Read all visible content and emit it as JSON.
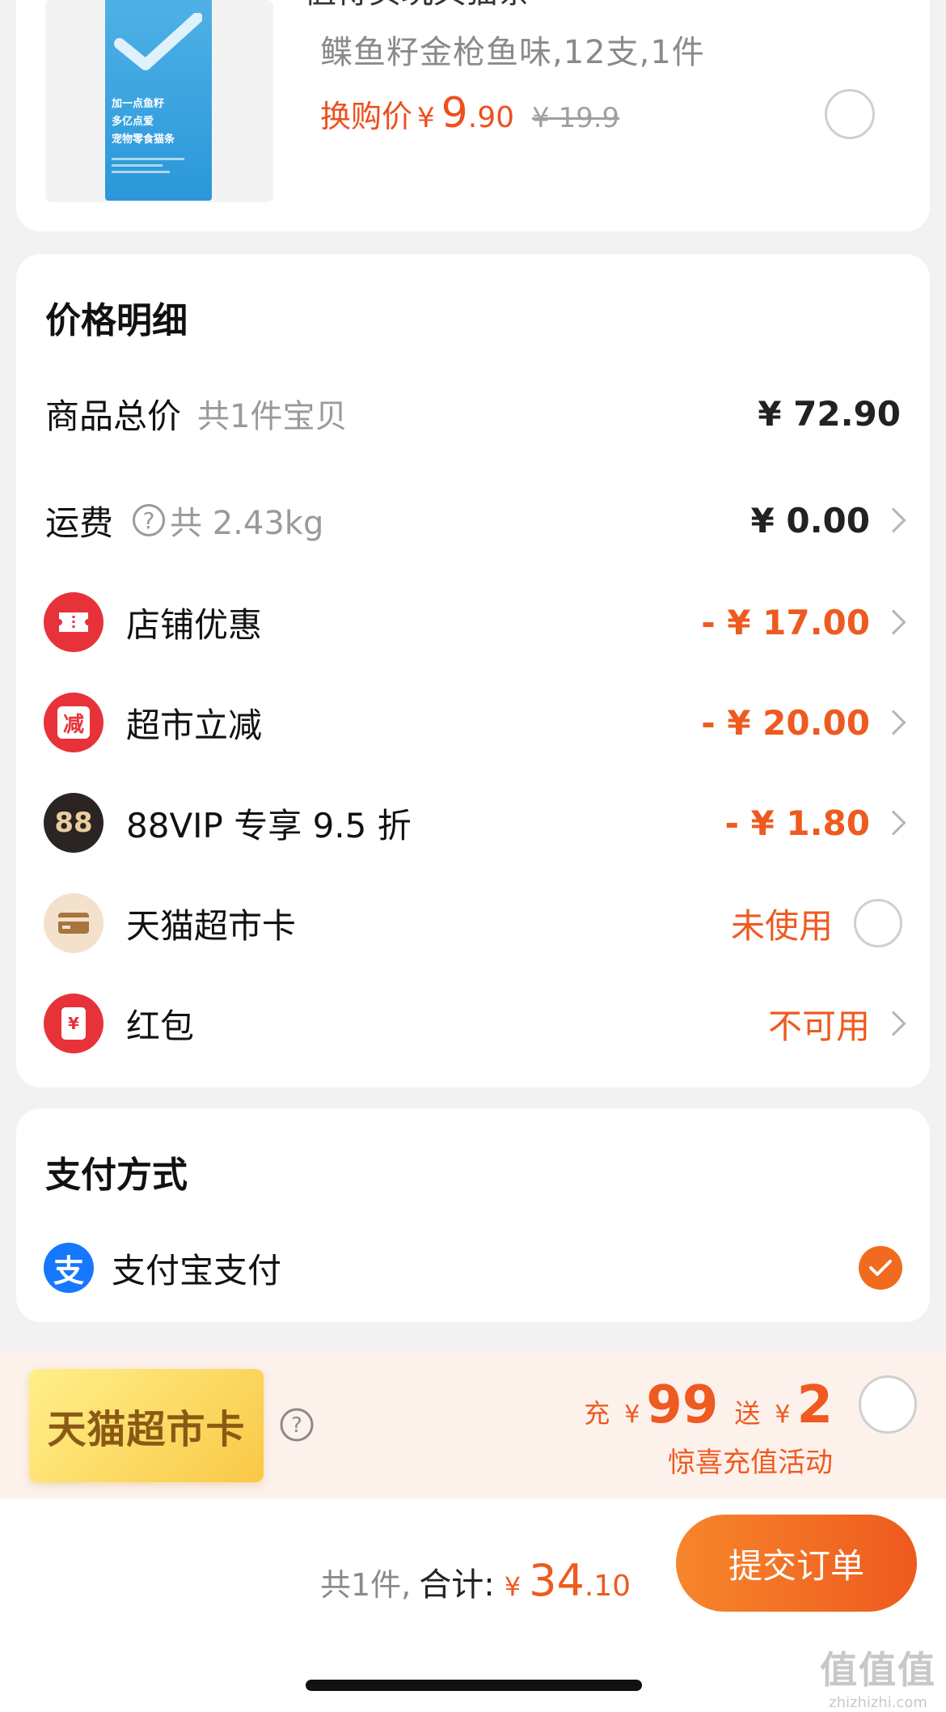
{
  "product": {
    "cut_title": "值得买玩具猫条",
    "spec": "鲽鱼籽金枪鱼味,12支,1件",
    "price_label": "换购价",
    "currency": "¥",
    "price_int": "9",
    "price_dec": ".90",
    "original_price": "¥ 19.9",
    "package_text_1": "加一点鱼籽",
    "package_text_2": "多亿点爱",
    "package_text_3": "宠物零食猫条",
    "selected": false
  },
  "price_detail": {
    "title": "价格明细",
    "rows": [
      {
        "label": "商品总价",
        "sub": "共1件宝贝",
        "value": "¥ 72.90"
      },
      {
        "label": "运费",
        "sub": "共 2.43kg",
        "value": "¥ 0.00",
        "icon": "question-icon"
      },
      {
        "label": "店铺优惠",
        "value": "- ¥ 17.00",
        "icon": "coupon-icon",
        "color": "#ee5a1f"
      },
      {
        "label": "超市立减",
        "value": "- ¥ 20.00",
        "icon": "reduce-icon",
        "icon_text": "减",
        "color": "#ee5a1f"
      },
      {
        "label": "88VIP 专享 9.5 折",
        "value": "- ¥ 1.80",
        "icon": "vip88-icon",
        "icon_text": "88",
        "color": "#ee5a1f"
      },
      {
        "label": "天猫超市卡",
        "value": "未使用",
        "icon": "card-icon",
        "selected": false
      },
      {
        "label": "红包",
        "value": "不可用",
        "icon": "red-packet-icon",
        "icon_text": "¥"
      }
    ]
  },
  "payment": {
    "title": "支付方式",
    "method": "支付宝支付",
    "icon_text": "支",
    "selected": true
  },
  "recharge": {
    "card_label": "天猫超市卡",
    "charge_word": "充",
    "charge_currency": "¥",
    "charge_amount": "99",
    "give_word": "送",
    "give_currency": "¥",
    "give_amount": "2",
    "subtitle": "惊喜充值活动",
    "selected": false
  },
  "footer": {
    "count": "共1件,",
    "total_label": "合计:",
    "currency": "¥",
    "total_int": "34",
    "total_dec": ".10",
    "submit_label": "提交订单"
  },
  "watermark": {
    "text": "值值值",
    "url": "zhizhizhi.com"
  },
  "colors": {
    "accent": "#ee5a1f",
    "alipay": "#1677ff",
    "background": "#f2f2f2"
  }
}
